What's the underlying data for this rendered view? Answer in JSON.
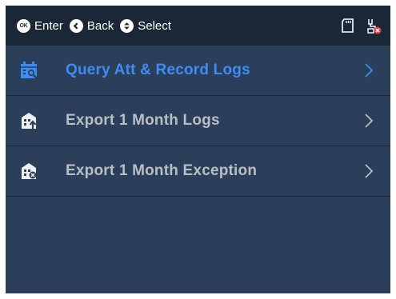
{
  "header": {
    "hints": [
      {
        "icon": "ok-icon",
        "icon_text": "OK",
        "label": "Enter"
      },
      {
        "icon": "back-icon",
        "label": "Back"
      },
      {
        "icon": "select-icon",
        "label": "Select"
      }
    ],
    "status_icons": [
      "sd-card-icon",
      "network-disconnected-icon"
    ]
  },
  "menu": {
    "items": [
      {
        "label": "Query Att & Record Logs",
        "icon": "calendar-search-icon",
        "selected": true
      },
      {
        "label": "Export 1 Month Logs",
        "icon": "building-export-icon",
        "selected": false
      },
      {
        "label": "Export 1 Month Exception",
        "icon": "building-exception-icon",
        "selected": false
      }
    ]
  },
  "colors": {
    "background": "#2b3f5a",
    "topbar": "#1a2737",
    "selected_text": "#3d8cf4",
    "normal_text": "#b9bec6",
    "alert": "#e33b3b"
  }
}
